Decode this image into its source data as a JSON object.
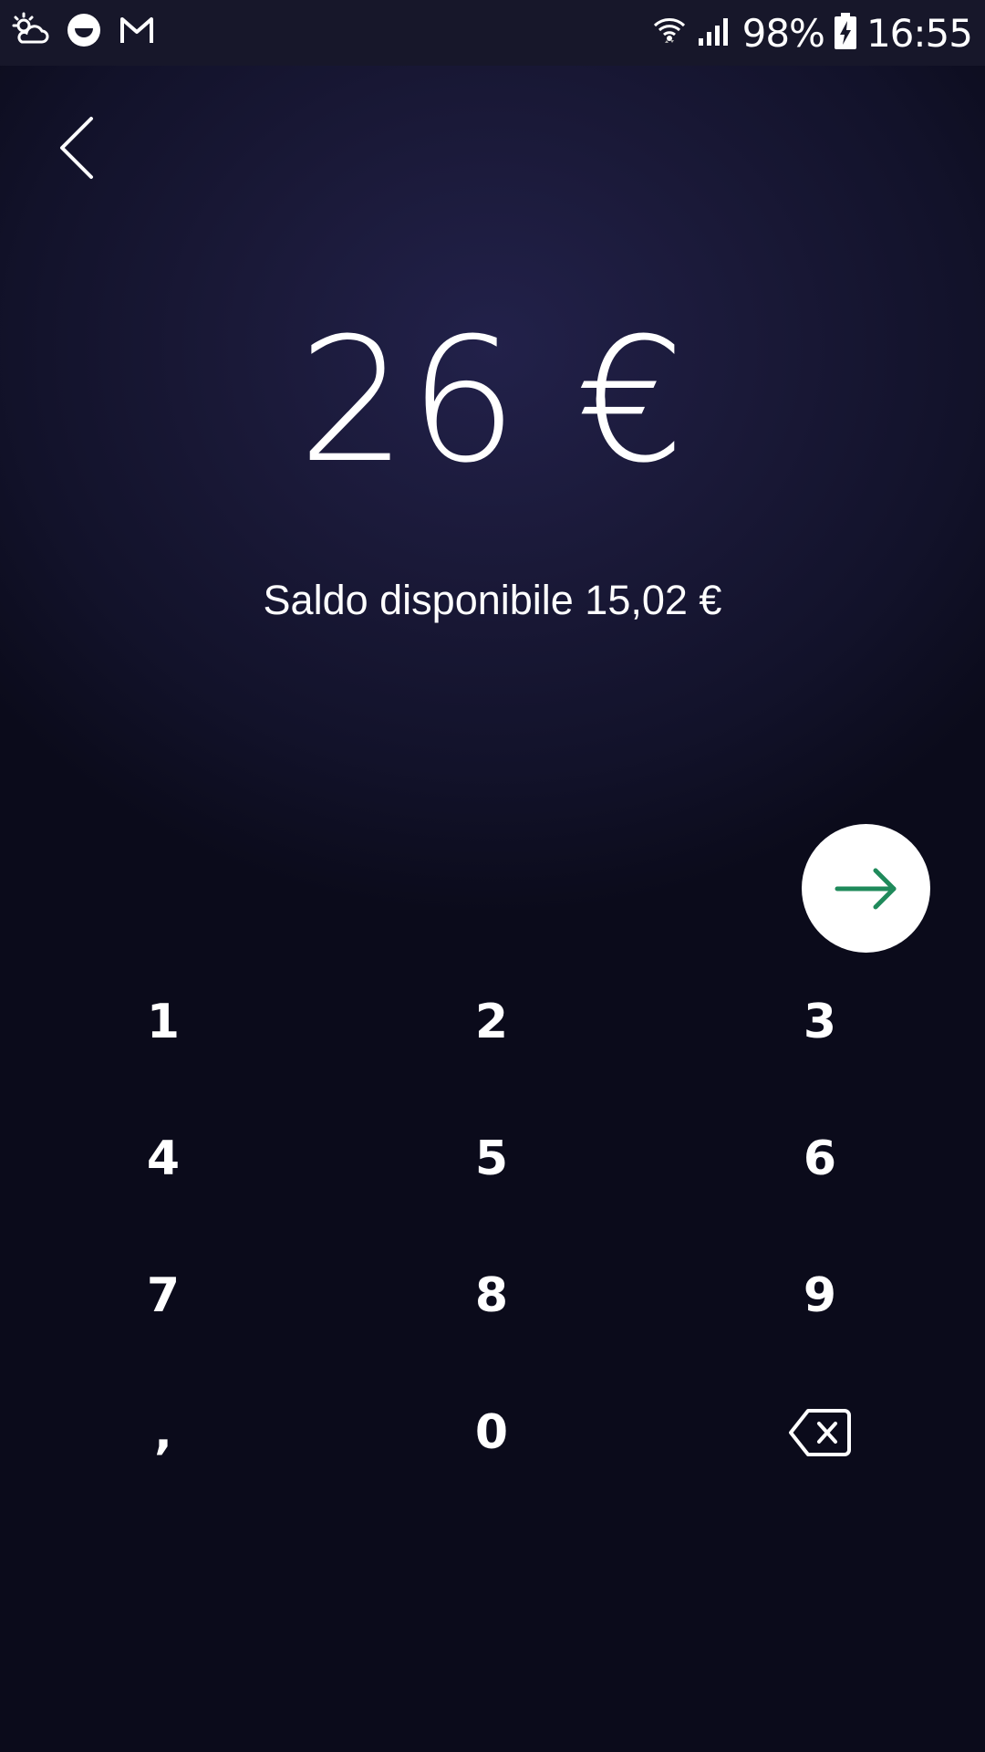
{
  "status_bar": {
    "left_icons": [
      "weather-icon",
      "app-icon",
      "gmail-icon"
    ],
    "battery": "98%",
    "time": "16:55"
  },
  "amount": {
    "value": "26 €"
  },
  "balance": {
    "text": "Saldo disponibile 15,02 €"
  },
  "keypad": {
    "keys": [
      "1",
      "2",
      "3",
      "4",
      "5",
      "6",
      "7",
      "8",
      "9",
      ",",
      "0"
    ]
  },
  "colors": {
    "accent": "#1f8a5b",
    "background": "#12122a",
    "text": "#ffffff"
  }
}
